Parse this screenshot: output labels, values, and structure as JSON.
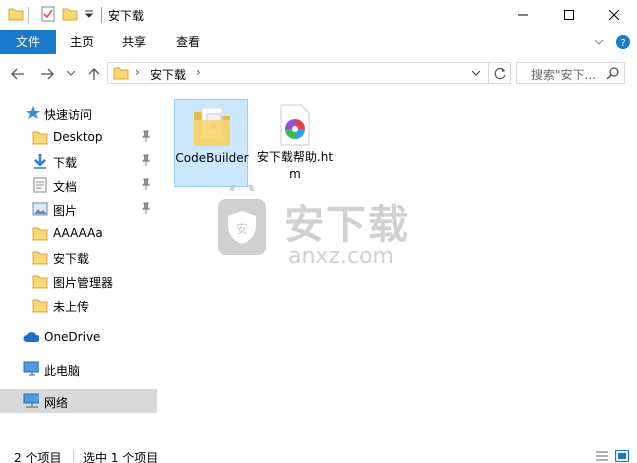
{
  "window": {
    "title": "安下载",
    "minimize_icon": "minimize-icon",
    "maximize_icon": "maximize-icon",
    "close_icon": "close-icon"
  },
  "ribbon": {
    "tabs": [
      {
        "label": "文件"
      },
      {
        "label": "主页"
      },
      {
        "label": "共享"
      },
      {
        "label": "查看"
      }
    ]
  },
  "address": {
    "path": [
      "安下载"
    ],
    "search_placeholder": "搜索\"安下..."
  },
  "sidebar": {
    "quick_access": "快速访问",
    "items": [
      {
        "label": "Desktop",
        "pinned": true,
        "icon": "folder-icon"
      },
      {
        "label": "下载",
        "pinned": true,
        "icon": "download-icon"
      },
      {
        "label": "文档",
        "pinned": true,
        "icon": "document-icon"
      },
      {
        "label": "图片",
        "pinned": true,
        "icon": "picture-icon"
      },
      {
        "label": "AAAAAa",
        "pinned": false,
        "icon": "folder-icon"
      },
      {
        "label": "安下载",
        "pinned": false,
        "icon": "folder-icon"
      },
      {
        "label": "图片管理器",
        "pinned": false,
        "icon": "folder-icon"
      },
      {
        "label": "未上传",
        "pinned": false,
        "icon": "folder-icon"
      }
    ],
    "onedrive": "OneDrive",
    "this_pc": "此电脑",
    "network": "网络"
  },
  "files": [
    {
      "name": "CodeBuilder",
      "type": "folder",
      "selected": true
    },
    {
      "name": "安下载帮助.htm",
      "type": "htm",
      "selected": false
    }
  ],
  "watermark": {
    "text_cn": "安下载",
    "text_en": "anxz.com"
  },
  "status": {
    "item_count": "2 个项目",
    "selected": "选中 1 个项目"
  },
  "colors": {
    "accent": "#1979ca",
    "selection": "#cce8ff",
    "sidebar_selected": "#d9d9d9"
  }
}
